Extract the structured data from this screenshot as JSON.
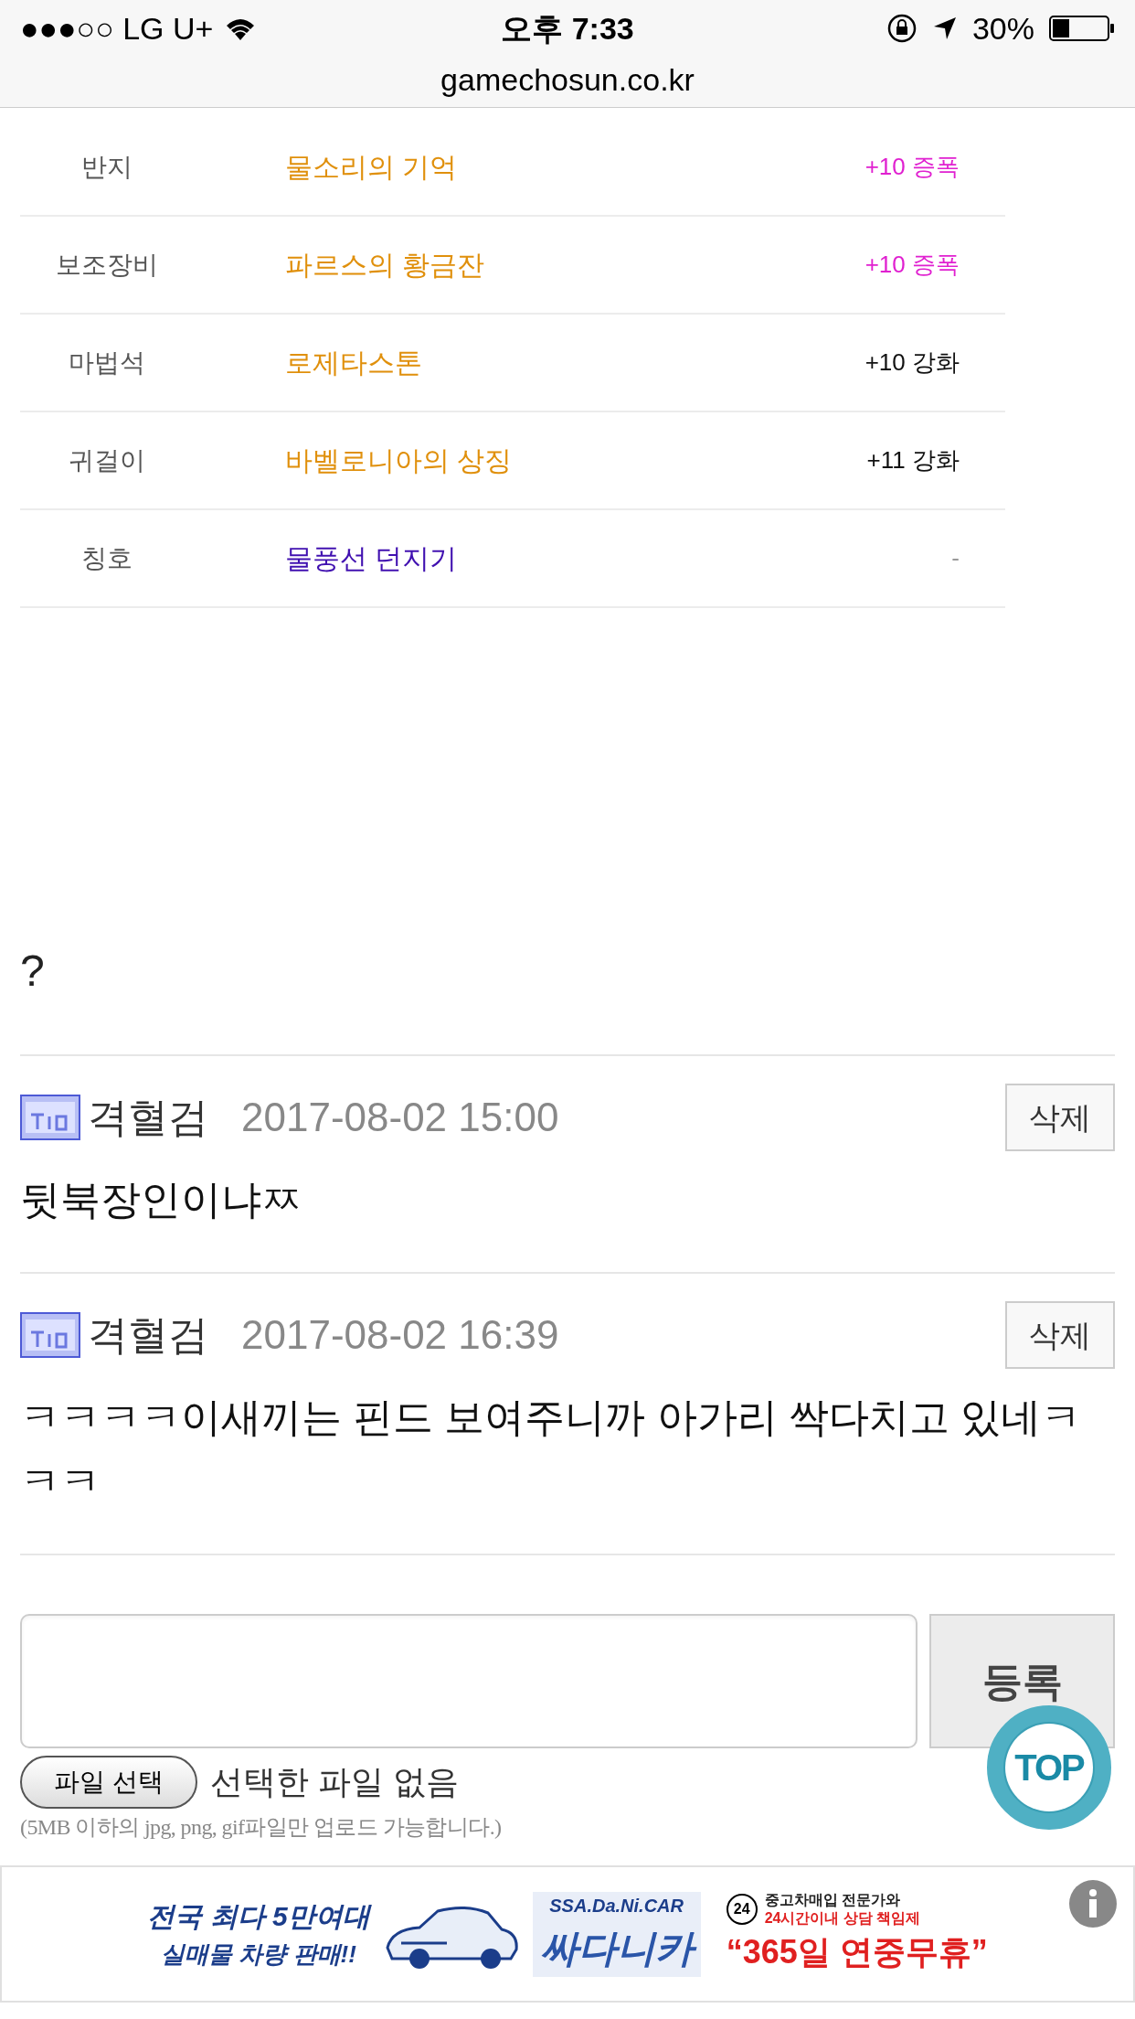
{
  "status_bar": {
    "carrier": "●●●○○ LG U+",
    "time": "오후 7:33",
    "battery": "30%",
    "url": "gamechosun.co.kr"
  },
  "equipment": [
    {
      "slot": "반지",
      "item": {
        "text": "물소리의 기억",
        "color": "#e0900c"
      },
      "enhance": {
        "text": "+10 증폭",
        "color": "#e020d0"
      }
    },
    {
      "slot": "보조장비",
      "item": {
        "text": "파르스의 황금잔",
        "color": "#e0900c"
      },
      "enhance": {
        "text": "+10 증폭",
        "color": "#e020d0"
      }
    },
    {
      "slot": "마법석",
      "item": {
        "text": "로제타스톤",
        "color": "#e0900c"
      },
      "enhance": {
        "text": "+10 강화",
        "color": "#111111"
      }
    },
    {
      "slot": "귀걸이",
      "item": {
        "text": "바벨로니아의 상징",
        "color": "#e0900c"
      },
      "enhance": {
        "text": "+11 강화",
        "color": "#111111"
      }
    },
    {
      "slot": "칭호",
      "item": {
        "text": "물풍선 던지기",
        "color": "#4010b0"
      },
      "enhance": {
        "text": "-",
        "color": "#999999"
      }
    }
  ],
  "post_text": "?",
  "comments": [
    {
      "author": "격혈검",
      "date": "2017-08-02 15:00",
      "delete": "삭제",
      "body": "뒷북장인이냐ㅉ"
    },
    {
      "author": "격혈검",
      "date": "2017-08-02 16:39",
      "delete": "삭제",
      "body": "ㅋㅋㅋㅋ이새끼는 핀드 보여주니까 아가리 싹다치고 있네ㅋㅋㅋ"
    }
  ],
  "comment_form": {
    "submit": "등록",
    "file_button": "파일 선택",
    "file_status": "선택한 파일 없음",
    "note": "(5MB 이하의 jpg, png, gif파일만 업로드 가능합니다.)"
  },
  "top_button": "TOP",
  "ad": {
    "line1": "전국 최다 5만여대",
    "line2": "실매물 차량 판매!!",
    "brand_en": "SSA.Da.Ni.CAR",
    "brand": "싸다니카",
    "badge": "24",
    "info1": "중고차매입 전문가와",
    "info2": "24시간이내 상담 책임제",
    "slogan": "“365일 연중무휴”"
  }
}
